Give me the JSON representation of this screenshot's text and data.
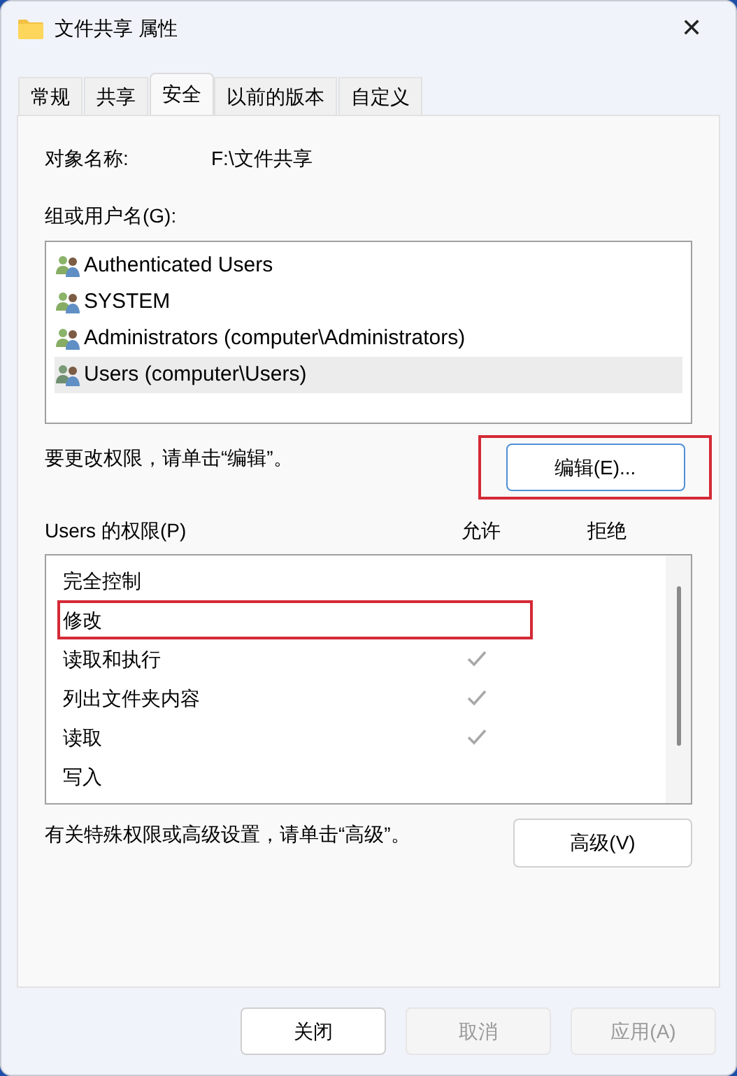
{
  "window": {
    "title": "文件共享 属性",
    "close": "✕"
  },
  "tabs": [
    {
      "label": "常规",
      "selected": false
    },
    {
      "label": "共享",
      "selected": false
    },
    {
      "label": "安全",
      "selected": true
    },
    {
      "label": "以前的版本",
      "selected": false
    },
    {
      "label": "自定义",
      "selected": false
    }
  ],
  "object_name": {
    "label": "对象名称:",
    "value": "F:\\文件共享"
  },
  "groups": {
    "label": "组或用户名(G):",
    "items": [
      {
        "name": "Authenticated Users",
        "selected": false
      },
      {
        "name": "SYSTEM",
        "selected": false
      },
      {
        "name": "Administrators (computer\\Administrators)",
        "selected": false
      },
      {
        "name": "Users (computer\\Users)",
        "selected": true
      }
    ]
  },
  "edit_hint": "要更改权限，请单击“编辑”。",
  "edit_button": {
    "label": "编辑(E)...",
    "highlighted": true
  },
  "permissions": {
    "label": "Users 的权限(P)",
    "allow_header": "允许",
    "deny_header": "拒绝",
    "rows": [
      {
        "name": "完全控制",
        "allow": false,
        "deny": false,
        "highlighted": false
      },
      {
        "name": "修改",
        "allow": false,
        "deny": false,
        "highlighted": true
      },
      {
        "name": "读取和执行",
        "allow": true,
        "deny": false,
        "highlighted": false
      },
      {
        "name": "列出文件夹内容",
        "allow": true,
        "deny": false,
        "highlighted": false
      },
      {
        "name": "读取",
        "allow": true,
        "deny": false,
        "highlighted": false
      },
      {
        "name": "写入",
        "allow": false,
        "deny": false,
        "highlighted": false
      }
    ]
  },
  "advanced_hint": "有关特殊权限或高级设置，请单击“高级”。",
  "advanced_button": "高级(V)",
  "buttons": [
    {
      "label": "关闭",
      "disabled": false
    },
    {
      "label": "取消",
      "disabled": true
    },
    {
      "label": "应用(A)",
      "disabled": true
    }
  ]
}
